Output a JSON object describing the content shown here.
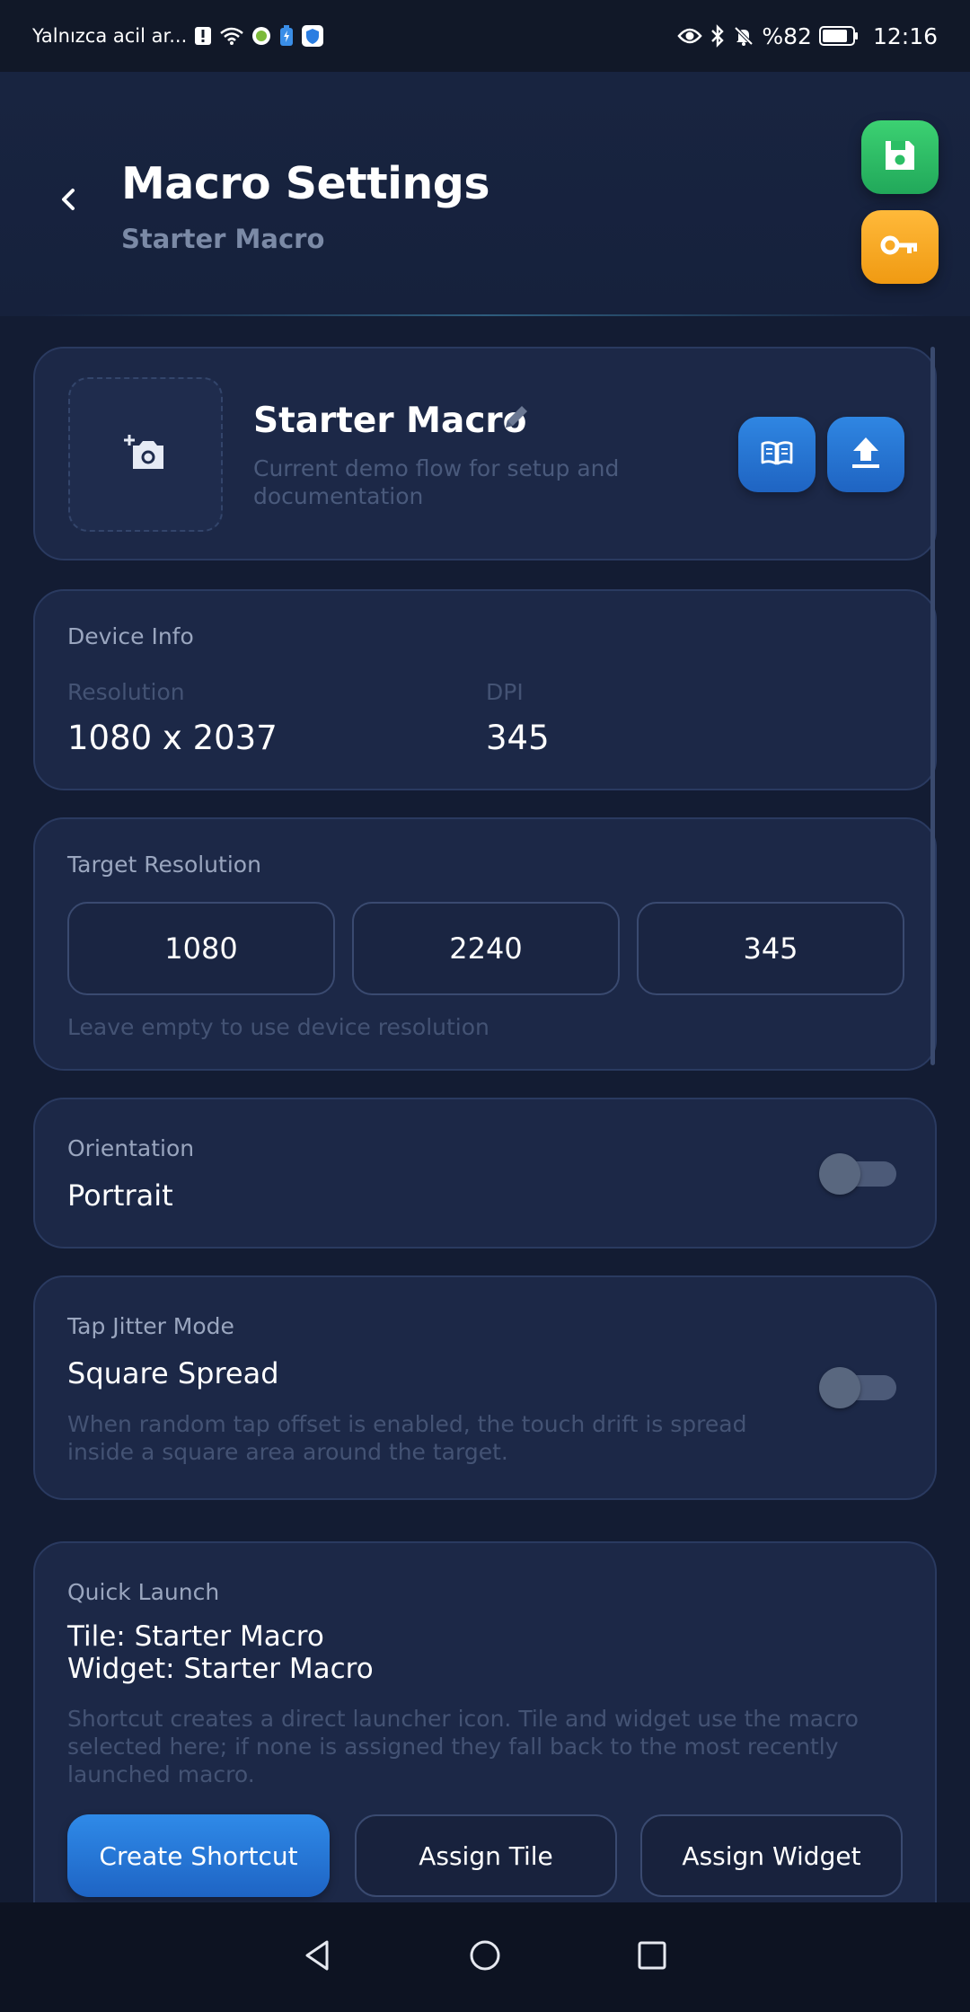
{
  "status_bar": {
    "carrier": "Yalnızca acil ar...",
    "battery_percent": "%82",
    "time": "12:16"
  },
  "header": {
    "title": "Macro Settings",
    "subtitle": "Starter Macro"
  },
  "macro": {
    "name": "Starter Macro",
    "description": "Current demo flow for setup and documentation"
  },
  "device_info": {
    "label": "Device Info",
    "resolution_label": "Resolution",
    "resolution_value": "1080 x 2037",
    "dpi_label": "DPI",
    "dpi_value": "345"
  },
  "target_resolution": {
    "label": "Target Resolution",
    "width": "1080",
    "height": "2240",
    "dpi": "345",
    "hint": "Leave empty to use device resolution"
  },
  "orientation": {
    "label": "Orientation",
    "value": "Portrait",
    "toggle_on": false
  },
  "tap_jitter": {
    "label": "Tap Jitter Mode",
    "value": "Square Spread",
    "description": "When random tap offset is enabled, the touch drift is spread inside a square area around the target.",
    "toggle_on": false
  },
  "quick_launch": {
    "label": "Quick Launch",
    "tile": "Tile: Starter Macro",
    "widget": "Widget: Starter Macro",
    "description": "Shortcut creates a direct launcher icon. Tile and widget use the macro selected here; if none is assigned they fall back to the most recently launched macro.",
    "create_shortcut": "Create Shortcut",
    "assign_tile": "Assign Tile",
    "assign_widget": "Assign Widget"
  },
  "colors": {
    "background": "#131c33",
    "card": "#1c2847",
    "accent_blue": "#2f86e2",
    "save_green": "#2bbf65",
    "key_orange": "#f5a623"
  },
  "icons": {
    "back": "chevron-left-icon",
    "save": "floppy-disk-icon",
    "key": "key-icon",
    "add_photo": "add-photo-icon",
    "edit": "pencil-icon",
    "docs": "book-icon",
    "export": "upload-icon"
  }
}
